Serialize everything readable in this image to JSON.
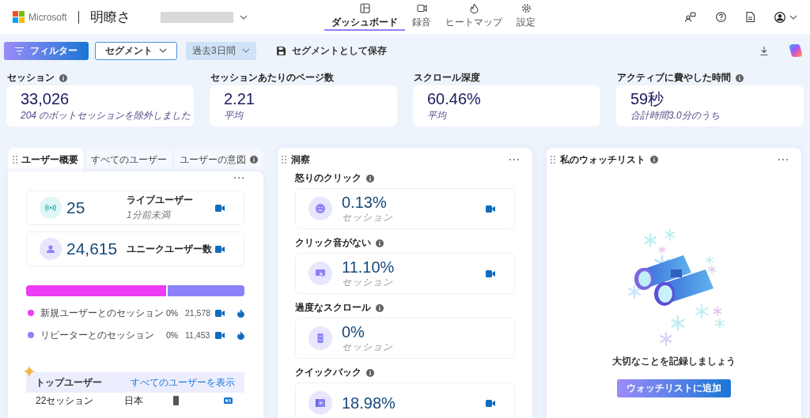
{
  "header": {
    "brand": "Microsoft",
    "product": "明瞭さ"
  },
  "nav": [
    {
      "label": "ダッシュボード",
      "selected": true
    },
    {
      "label": "録音",
      "selected": false
    },
    {
      "label": "ヒートマップ",
      "selected": false
    },
    {
      "label": "設定",
      "selected": false
    }
  ],
  "toolbar": {
    "filter": "フィルター",
    "segment": "セグメント",
    "date_range": "過去3日間",
    "save": "セグメントとして保存"
  },
  "metrics": [
    {
      "label": "セッション",
      "info": true,
      "value": "33,026",
      "note": "204 のボットセッションを除外しました"
    },
    {
      "label": "セッションあたりのページ数",
      "info": false,
      "value": "2.21",
      "note": "平均"
    },
    {
      "label": "スクロール深度",
      "info": false,
      "value": "60.46%",
      "note": "平均"
    },
    {
      "label": "アクティブに費やした時間",
      "info": true,
      "value": "59秒",
      "note": "合計時間3.0分のうち"
    }
  ],
  "user_panel": {
    "tabs": [
      {
        "label": "ユーザー概要",
        "selected": true,
        "info": false
      },
      {
        "label": "すべてのユーザー",
        "selected": false,
        "info": false
      },
      {
        "label": "ユーザーの意図",
        "selected": false,
        "info": true
      }
    ],
    "stats": [
      {
        "kind": "live",
        "value": "25",
        "label": "ライブユーザー",
        "note": "1分前未満"
      },
      {
        "kind": "unique",
        "value": "24,615",
        "label": "ユニークユーザー数"
      }
    ],
    "split": [
      {
        "label": "新規ユーザーとのセッション",
        "percent": "0%",
        "count": "21,578",
        "color": "#ee3bf5",
        "level": 0.65
      },
      {
        "label": "リピーターとのセッション",
        "percent": "0%",
        "count": "11,453",
        "color": "#8b82f7",
        "level": 0.35
      }
    ],
    "top_users": {
      "title": "トップユーザー",
      "link": "すべてのユーザーを表示",
      "rows": [
        {
          "sessions": "22セッション",
          "country": "日本"
        }
      ]
    }
  },
  "insights": {
    "title": "洞察",
    "items": [
      {
        "label": "怒りのクリック",
        "kind": "angry",
        "value": "0.13%",
        "caption": "セッション",
        "recording": true
      },
      {
        "label": "クリック音がない",
        "kind": "cursor",
        "value": "11.10%",
        "caption": "セッション",
        "recording": true
      },
      {
        "label": "過度なスクロール",
        "kind": "scroll",
        "value": "0%",
        "caption": "セッション",
        "recording": false
      },
      {
        "label": "クイックバック",
        "kind": "quickback",
        "value": "18.98%",
        "recording": true
      }
    ]
  },
  "watchlist": {
    "title": "私のウォッチリスト",
    "message": "大切なことを記録しましょう",
    "button": "ウォッチリストに追加"
  }
}
